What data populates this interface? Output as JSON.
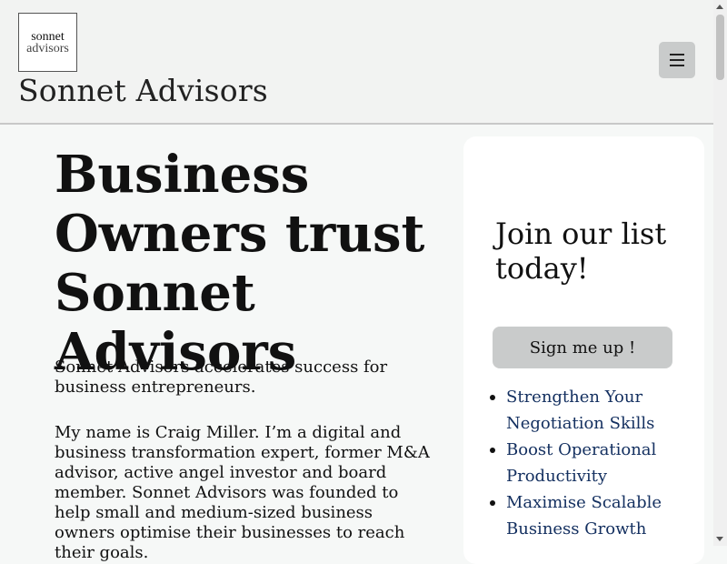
{
  "header": {
    "logo_line1": "sonnet",
    "logo_line2": "advisors",
    "site_title": "Sonnet Advisors",
    "menu_icon": "hamburger-icon"
  },
  "hero": {
    "title": "Business Owners trust Sonnet Advisors",
    "intro": "Sonnet Advisors accelerates success for business entrepreneurs.",
    "bio": "My name is Craig Miller.   I’m a digital and business transformation expert, former M&A advisor, active angel investor and board member.   Sonnet Advisors was founded to help small and medium-sized business owners optimise their businesses to reach their goals."
  },
  "signup": {
    "title": "Join our list today!",
    "button_label": "Sign me up !",
    "benefits": [
      "Strengthen Your Negotiation Skills",
      "Boost Operational Productivity",
      "Maximise Scalable Business Growth"
    ]
  },
  "colors": {
    "background": "#f6f8f7",
    "header": "#f2f3f2",
    "button": "#c9cbcb",
    "link": "#143060"
  }
}
